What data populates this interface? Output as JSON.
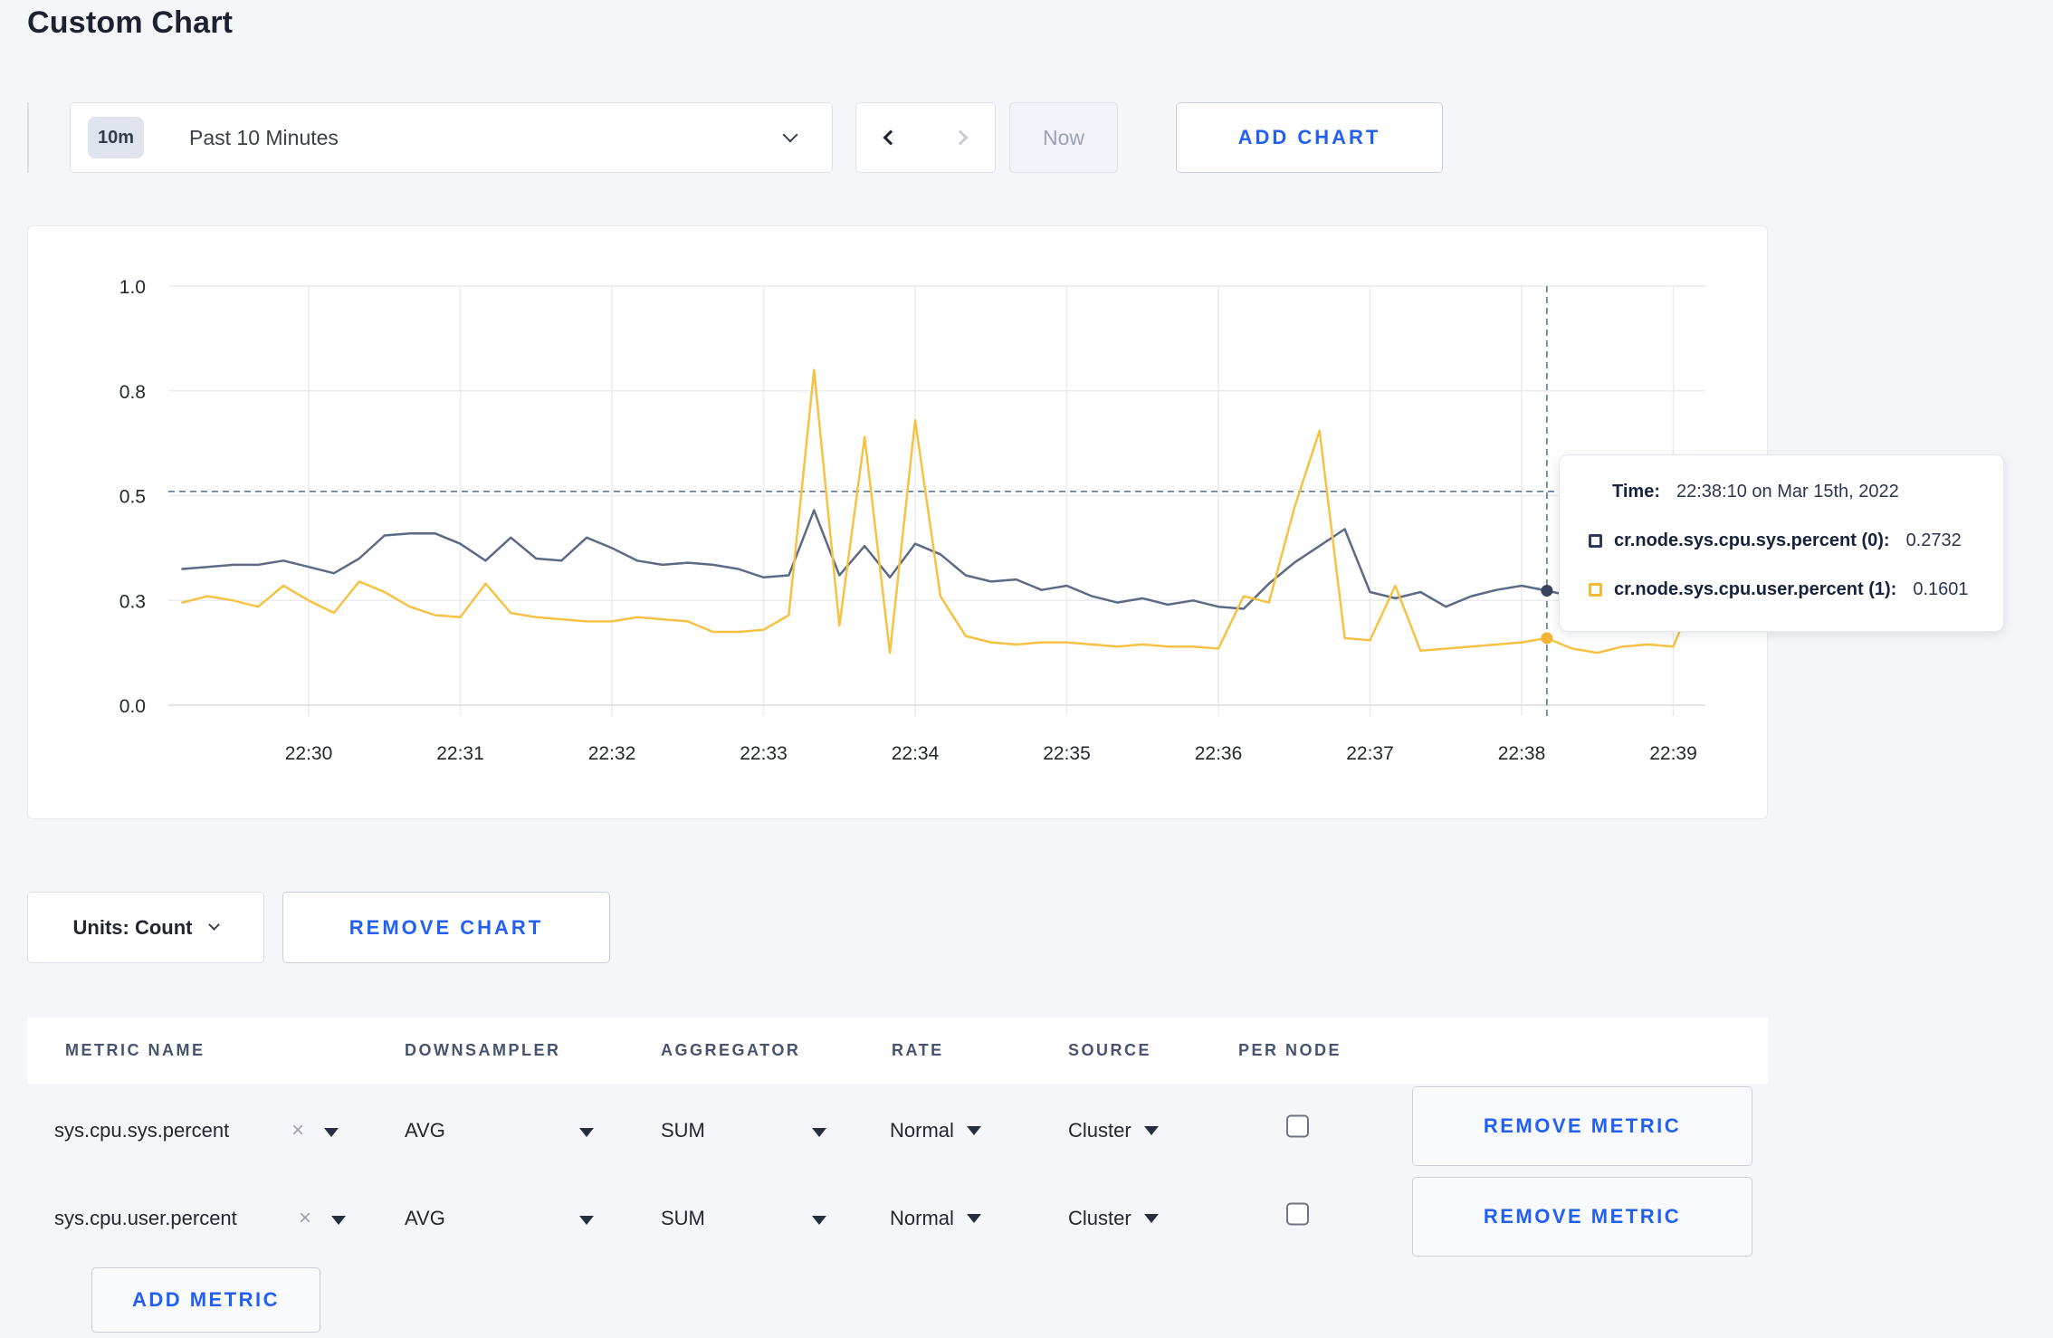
{
  "page": {
    "title": "Custom Chart"
  },
  "toolbar": {
    "time_window": {
      "badge": "10m",
      "label": "Past 10 Minutes"
    },
    "now_label": "Now",
    "add_chart_label": "ADD CHART"
  },
  "tooltip": {
    "time_label": "Time:",
    "time_value": "22:38:10 on Mar 15th, 2022",
    "series": [
      {
        "label": "cr.node.sys.cpu.sys.percent (0):",
        "value": "0.2732",
        "color": "#2B3A5C"
      },
      {
        "label": "cr.node.sys.cpu.user.percent (1):",
        "value": "0.1601",
        "color": "#F5B936"
      }
    ]
  },
  "units_bar": {
    "units_label": "Units: Count",
    "remove_chart_label": "REMOVE CHART"
  },
  "metrics_table": {
    "headers": [
      "METRIC NAME",
      "DOWNSAMPLER",
      "AGGREGATOR",
      "RATE",
      "SOURCE",
      "PER NODE"
    ],
    "remove_icon": "×",
    "remove_metric_label": "REMOVE METRIC",
    "add_metric_label": "ADD METRIC",
    "rows": [
      {
        "metric": "sys.cpu.sys.percent",
        "downsampler": "AVG",
        "aggregator": "SUM",
        "rate": "Normal",
        "source": "Cluster",
        "per_node": false
      },
      {
        "metric": "sys.cpu.user.percent",
        "downsampler": "AVG",
        "aggregator": "SUM",
        "rate": "Normal",
        "source": "Cluster",
        "per_node": false
      }
    ]
  },
  "chart_data": {
    "type": "line",
    "title": "",
    "xlabel": "",
    "ylabel": "",
    "ylim": [
      0,
      1
    ],
    "grid": true,
    "legend_position": "tooltip",
    "x": {
      "t0": 10,
      "dt": 10,
      "reference": "seconds after 22:29:00",
      "points": 61
    },
    "x_axis": {
      "labels": [
        "22:30",
        "22:31",
        "22:32",
        "22:33",
        "22:34",
        "22:35",
        "22:36",
        "22:37",
        "22:38",
        "22:39"
      ]
    },
    "y_axis": {
      "ticks": [
        {
          "value": 0,
          "label": "0.0"
        },
        {
          "value": 0.25,
          "label": "0.3"
        },
        {
          "value": 0.5,
          "label": "0.5"
        },
        {
          "value": 0.75,
          "label": "0.8"
        },
        {
          "value": 1,
          "label": "1.0"
        }
      ]
    },
    "crosshair": {
      "value": 0.51,
      "time_seconds": 550,
      "time_label": "22:38:10"
    },
    "colors": {
      "grid": "#EBECEF",
      "axis": "#D8DBE1",
      "crosshair": "#4C708E"
    },
    "series": [
      {
        "name": "cr.node.sys.cpu.sys.percent",
        "color": "#5C6A85",
        "dot_color": "#39425C",
        "hover_value": 0.2732,
        "values": [
          0.325,
          0.33,
          0.335,
          0.335,
          0.345,
          0.33,
          0.315,
          0.35,
          0.405,
          0.41,
          0.41,
          0.385,
          0.345,
          0.4,
          0.35,
          0.345,
          0.4,
          0.375,
          0.345,
          0.335,
          0.34,
          0.335,
          0.325,
          0.305,
          0.31,
          0.465,
          0.31,
          0.38,
          0.305,
          0.385,
          0.36,
          0.31,
          0.295,
          0.3,
          0.275,
          0.285,
          0.26,
          0.245,
          0.255,
          0.24,
          0.25,
          0.235,
          0.23,
          0.29,
          0.34,
          0.38,
          0.42,
          0.27,
          0.255,
          0.27,
          0.235,
          0.26,
          0.275,
          0.285,
          0.2732,
          0.26,
          0.27,
          0.26,
          0.255,
          0.26,
          0.3
        ]
      },
      {
        "name": "cr.node.sys.cpu.user.percent",
        "color": "#F6C244",
        "dot_color": "#F2B437",
        "hover_value": 0.1601,
        "values": [
          0.245,
          0.26,
          0.25,
          0.235,
          0.285,
          0.25,
          0.22,
          0.295,
          0.27,
          0.235,
          0.215,
          0.21,
          0.29,
          0.22,
          0.21,
          0.205,
          0.2,
          0.2,
          0.21,
          0.205,
          0.2,
          0.175,
          0.175,
          0.18,
          0.215,
          0.8,
          0.19,
          0.64,
          0.125,
          0.68,
          0.26,
          0.165,
          0.15,
          0.145,
          0.15,
          0.15,
          0.145,
          0.14,
          0.145,
          0.14,
          0.14,
          0.135,
          0.26,
          0.245,
          0.47,
          0.655,
          0.16,
          0.155,
          0.285,
          0.13,
          0.135,
          0.14,
          0.145,
          0.15,
          0.1601,
          0.135,
          0.125,
          0.14,
          0.145,
          0.14,
          0.285
        ]
      }
    ]
  }
}
